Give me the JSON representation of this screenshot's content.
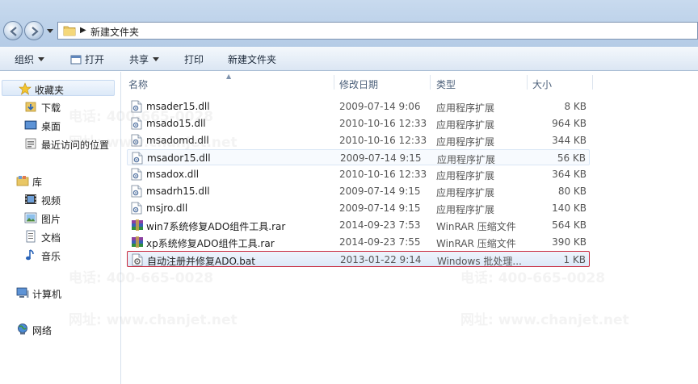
{
  "address": {
    "path": "新建文件夹"
  },
  "toolbar": {
    "organize": "组织",
    "open": "打开",
    "share": "共享",
    "print": "打印",
    "new_folder": "新建文件夹"
  },
  "nav": {
    "favorites": "收藏夹",
    "downloads": "下载",
    "desktop": "桌面",
    "recent": "最近访问的位置",
    "libraries": "库",
    "videos": "视频",
    "pictures": "图片",
    "documents": "文档",
    "music": "音乐",
    "computer": "计算机",
    "network": "网络"
  },
  "columns": {
    "name": "名称",
    "date": "修改日期",
    "type": "类型",
    "size": "大小"
  },
  "files": [
    {
      "name": "msader15.dll",
      "date": "2009-07-14 9:06",
      "type": "应用程序扩展",
      "size": "8 KB",
      "kind": "dll"
    },
    {
      "name": "msado15.dll",
      "date": "2010-10-16 12:33",
      "type": "应用程序扩展",
      "size": "964 KB",
      "kind": "dll"
    },
    {
      "name": "msadomd.dll",
      "date": "2010-10-16 12:33",
      "type": "应用程序扩展",
      "size": "344 KB",
      "kind": "dll"
    },
    {
      "name": "msador15.dll",
      "date": "2009-07-14 9:15",
      "type": "应用程序扩展",
      "size": "56 KB",
      "kind": "dll"
    },
    {
      "name": "msadox.dll",
      "date": "2010-10-16 12:33",
      "type": "应用程序扩展",
      "size": "364 KB",
      "kind": "dll"
    },
    {
      "name": "msadrh15.dll",
      "date": "2009-07-14 9:15",
      "type": "应用程序扩展",
      "size": "80 KB",
      "kind": "dll"
    },
    {
      "name": "msjro.dll",
      "date": "2009-07-14 9:15",
      "type": "应用程序扩展",
      "size": "140 KB",
      "kind": "dll"
    },
    {
      "name": "win7系统修复ADO组件工具.rar",
      "date": "2014-09-23 7:53",
      "type": "WinRAR 压缩文件",
      "size": "564 KB",
      "kind": "rar"
    },
    {
      "name": "xp系统修复ADO组件工具.rar",
      "date": "2014-09-23 7:55",
      "type": "WinRAR 压缩文件",
      "size": "390 KB",
      "kind": "rar"
    },
    {
      "name": "自动注册并修复ADO.bat",
      "date": "2013-01-22 9:14",
      "type": "Windows 批处理...",
      "size": "1 KB",
      "kind": "bat"
    }
  ],
  "watermark": {
    "phone": "电话: 400-665-0028",
    "site": "网址: www.chanjet.net"
  }
}
